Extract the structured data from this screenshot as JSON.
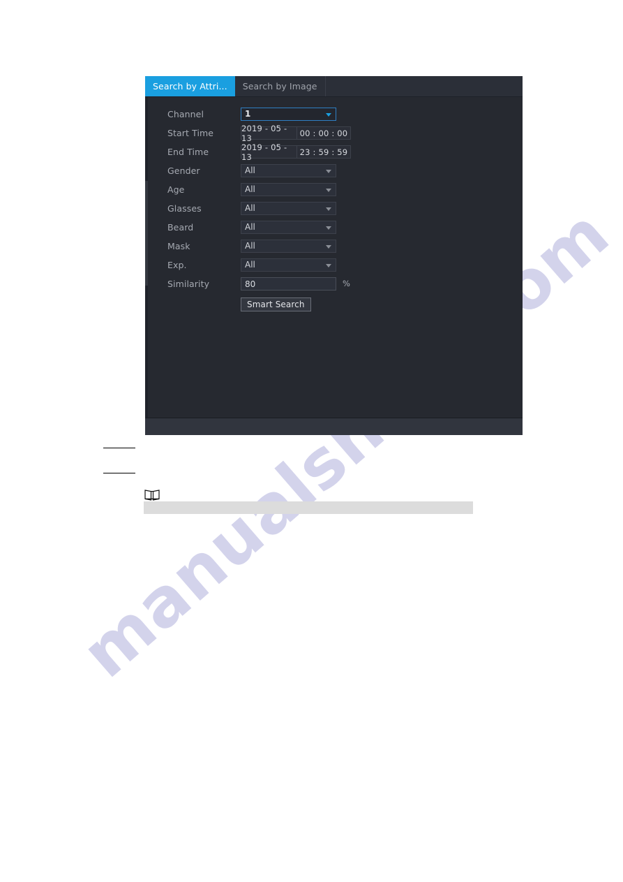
{
  "panel": {
    "tabs": [
      {
        "label": "Search by Attri...",
        "active": true
      },
      {
        "label": "Search by Image",
        "active": false
      }
    ],
    "colors": {
      "tab_active_bg": "#1a9fe0",
      "panel_bg": "#262930",
      "field_border": "#3d414b",
      "focus_border": "#2f7fc4"
    },
    "form": {
      "channel": {
        "label": "Channel",
        "value": "1",
        "control": "select",
        "focused": true,
        "arrow_icon": "chevron-down-icon"
      },
      "start_time": {
        "label": "Start Time",
        "date": "2019 - 05 - 13",
        "time": "00 : 00 : 00",
        "control": "datetime"
      },
      "end_time": {
        "label": "End Time",
        "date": "2019 - 05 - 13",
        "time": "23 : 59 : 59",
        "control": "datetime"
      },
      "gender": {
        "label": "Gender",
        "value": "All",
        "control": "select",
        "arrow_icon": "chevron-down-icon"
      },
      "age": {
        "label": "Age",
        "value": "All",
        "control": "select",
        "arrow_icon": "chevron-down-icon"
      },
      "glasses": {
        "label": "Glasses",
        "value": "All",
        "control": "select",
        "arrow_icon": "chevron-down-icon"
      },
      "beard": {
        "label": "Beard",
        "value": "All",
        "control": "select",
        "arrow_icon": "chevron-down-icon"
      },
      "mask": {
        "label": "Mask",
        "value": "All",
        "control": "select",
        "arrow_icon": "chevron-down-icon"
      },
      "exp": {
        "label": "Exp.",
        "value": "All",
        "control": "select",
        "arrow_icon": "chevron-down-icon"
      },
      "similarity": {
        "label": "Similarity",
        "value": "80",
        "unit": "%",
        "control": "text"
      }
    },
    "actions": {
      "smart_search_label": "Smart Search"
    }
  },
  "document": {
    "note_icon": "open-book-icon",
    "watermark": "manualshive.com"
  }
}
